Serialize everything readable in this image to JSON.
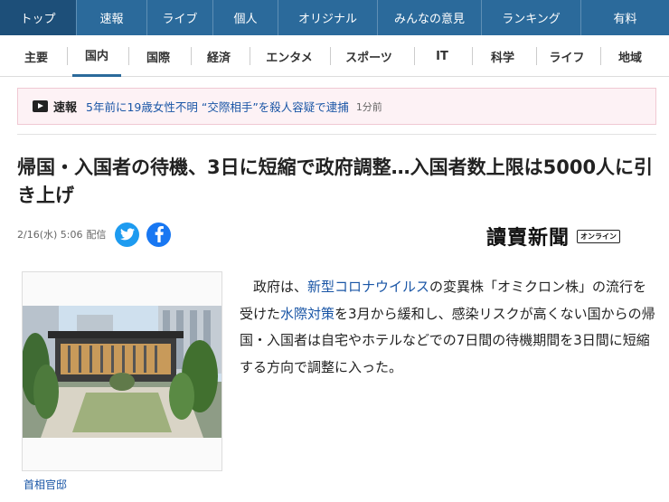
{
  "top_nav": [
    {
      "label": "トップ",
      "active": true
    },
    {
      "label": "速報"
    },
    {
      "label": "ライブ"
    },
    {
      "label": "個人"
    },
    {
      "label": "オリジナル"
    },
    {
      "label": "みんなの意見"
    },
    {
      "label": "ランキング"
    },
    {
      "label": "有料"
    }
  ],
  "categories": [
    {
      "label": "主要"
    },
    {
      "label": "国内",
      "active": true
    },
    {
      "label": "国際"
    },
    {
      "label": "経済"
    },
    {
      "label": "エンタメ"
    },
    {
      "label": "スポーツ"
    },
    {
      "label": "IT"
    },
    {
      "label": "科学"
    },
    {
      "label": "ライフ"
    },
    {
      "label": "地域"
    }
  ],
  "breaking": {
    "label": "速報",
    "headline": "5年前に19歳女性不明 “交際相手”を殺人容疑で逮捕",
    "time": "1分前"
  },
  "article": {
    "title": "帰国・入国者の待機、3日に短縮で政府調整…入国者数上限は5000人に引き上げ",
    "date": "2/16(水) 5:06",
    "delivery": "配信",
    "publisher": "讀賣新聞",
    "publisher_badge": "オンライン",
    "photo_caption": "首相官邸",
    "body": {
      "p1": "政府は、",
      "link1": "新型コロナウイルス",
      "p2": "の変異株「オミクロン株」の流行を受けた",
      "link2": "水際対策",
      "p3": "を3月から緩和し、感染リスクが高くない国からの帰国・入国者は自宅やホテルなどでの7日間の待機期間を3日間に短縮する方向で調整に入った。"
    }
  },
  "icons": {
    "play": "play-icon",
    "twitter": "twitter-icon",
    "facebook": "facebook-icon"
  },
  "colors": {
    "nav_bg": "#2b6a9b",
    "nav_active": "#1d4f79",
    "link": "#1a56a6",
    "breaking_bg": "#fdf2f5"
  }
}
